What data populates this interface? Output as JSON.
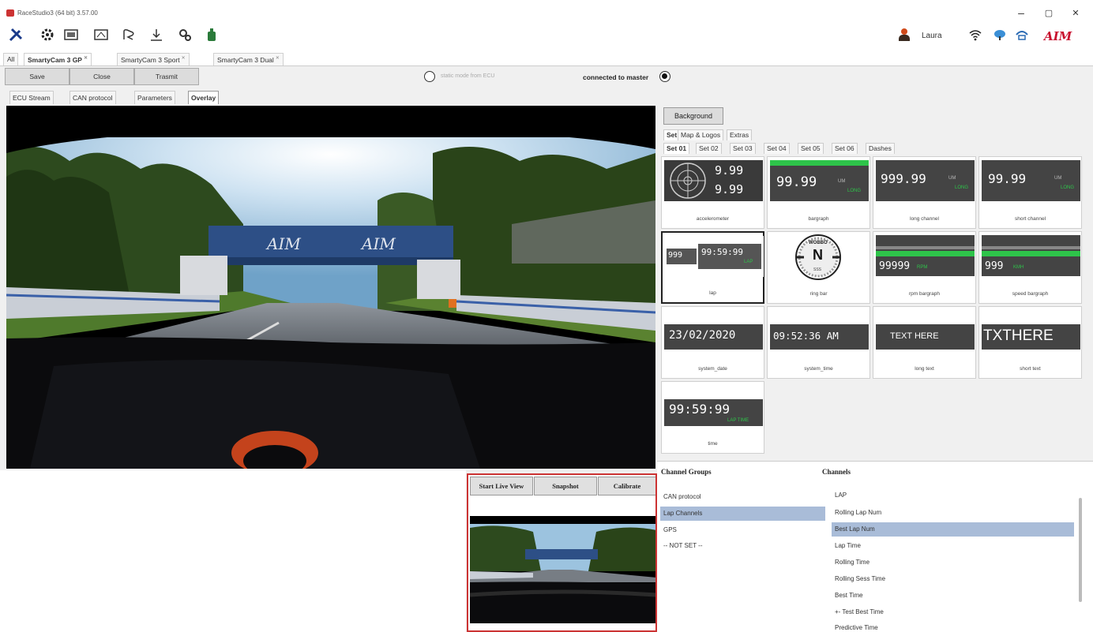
{
  "window": {
    "title": "RaceStudio3 (64 bit) 3.57.00",
    "controls": {
      "minimize": "–",
      "maximize": "▢",
      "close": "✕"
    }
  },
  "toolbar": {
    "icons": [
      "tools-icon",
      "gear-icon",
      "device-icon",
      "device-config-icon",
      "track-icon",
      "download-icon",
      "settings-icon",
      "bottle-icon"
    ],
    "user_name": "Laura",
    "brand": "AIM"
  },
  "device_tabs": [
    {
      "label": "All",
      "active": false
    },
    {
      "label": "SmartyCam 3 GP",
      "active": true
    },
    {
      "label": "SmartyCam 3 Sport",
      "active": false
    },
    {
      "label": "SmartyCam 3 Dual",
      "active": false
    }
  ],
  "actions": {
    "save": "Save",
    "close": "Close",
    "transmit": "Trasmit",
    "radio_left_label": "static mode from ECU",
    "radio_right_label": "connected to master"
  },
  "sub_tabs": [
    {
      "label": "ECU Stream",
      "active": false
    },
    {
      "label": "CAN protocol",
      "active": false
    },
    {
      "label": "Parameters",
      "active": false
    },
    {
      "label": "Overlay",
      "active": true
    }
  ],
  "video_banner_text": [
    "AIM",
    "AIM"
  ],
  "preview": {
    "start_live_view": "Start Live View",
    "snapshot": "Snapshot",
    "calibrate": "Calibrate"
  },
  "right_panel": {
    "background_button": "Background",
    "tabs": [
      {
        "label": "Set",
        "active": true
      },
      {
        "label": "Map & Logos",
        "active": false
      },
      {
        "label": "Extras",
        "active": false
      }
    ],
    "set_tabs": [
      {
        "label": "Set 01",
        "active": true
      },
      {
        "label": "Set 02",
        "active": false
      },
      {
        "label": "Set 03",
        "active": false
      },
      {
        "label": "Set 04",
        "active": false
      },
      {
        "label": "Set 05",
        "active": false
      },
      {
        "label": "Set 06",
        "active": false
      },
      {
        "label": "Dashes",
        "active": false
      }
    ],
    "widgets": [
      {
        "caption": "accelerometer",
        "v1": "9.99",
        "v2": "9.99"
      },
      {
        "caption": "bargraph",
        "value": "99.99",
        "unit": "UM",
        "sub": "LONG"
      },
      {
        "caption": "long channel",
        "value": "999.99",
        "unit": "UM",
        "sub": "LONG"
      },
      {
        "caption": "short channel",
        "value": "99.99",
        "unit": "UM",
        "sub": "LONG"
      },
      {
        "caption": "lap",
        "v1": "999",
        "v2": "99:59:99",
        "sub": "LAP"
      },
      {
        "caption": "ring bar",
        "heading": "N",
        "top_label": "WOBBO",
        "bottom_label": "SSS"
      },
      {
        "caption": "rpm bargraph",
        "value": "99999",
        "unit": "RPM"
      },
      {
        "caption": "speed bargraph",
        "value": "999",
        "unit": "KMH"
      },
      {
        "caption": "system_date",
        "value": "23/02/2020"
      },
      {
        "caption": "system_time",
        "value": "09:52:36 AM"
      },
      {
        "caption": "long text",
        "value": "TEXT HERE"
      },
      {
        "caption": "short text",
        "value": "TXTHERE"
      },
      {
        "caption": "time",
        "value": "99:59:99",
        "sub": "LAP TIME"
      }
    ]
  },
  "channels_panel": {
    "groups_header": "Channel Groups",
    "channels_header": "Channels",
    "groups": [
      {
        "label": "CAN protocol",
        "selected": false
      },
      {
        "label": "Lap Channels",
        "selected": true
      },
      {
        "label": "GPS",
        "selected": false
      },
      {
        "label": "-- NOT SET --",
        "selected": false
      }
    ],
    "channels": [
      {
        "label": "LAP",
        "selected": false
      },
      {
        "label": "Rolling Lap Num",
        "selected": false
      },
      {
        "label": "Best Lap Num",
        "selected": true
      },
      {
        "label": "Lap Time",
        "selected": false
      },
      {
        "label": "Rolling Time",
        "selected": false
      },
      {
        "label": "Rolling Sess Time",
        "selected": false
      },
      {
        "label": "Best Time",
        "selected": false
      },
      {
        "label": "+- Test Best Time",
        "selected": false
      },
      {
        "label": "Predictive Time",
        "selected": false
      }
    ]
  },
  "colors": {
    "accent_green": "#2ec44a",
    "selection_blue": "#a9bcd8",
    "preview_border": "#cc3333",
    "brand_red": "#c8102e"
  }
}
